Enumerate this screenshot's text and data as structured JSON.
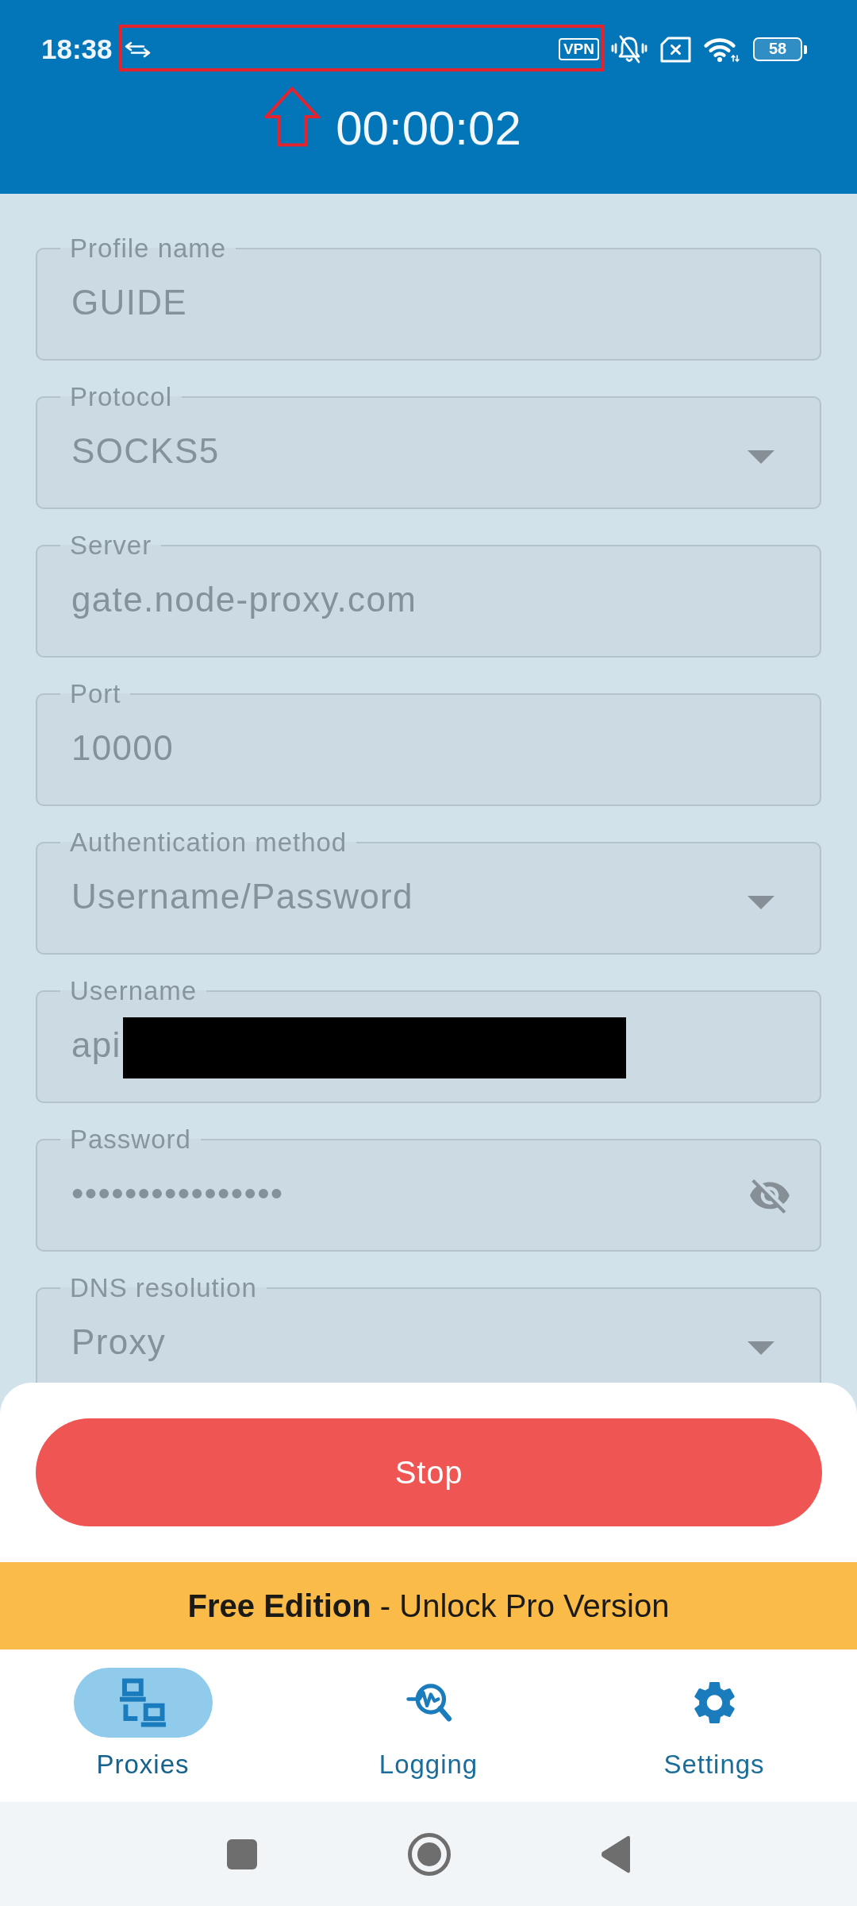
{
  "status_bar": {
    "time": "18:38",
    "vpn_badge": "VPN",
    "battery": "58"
  },
  "annotations": {
    "highlight_frame": true,
    "arrow": true
  },
  "header": {
    "timer": "00:00:02"
  },
  "form": {
    "disabled": true,
    "fields": [
      {
        "label": "Profile name",
        "value": "GUIDE",
        "kind": "text",
        "redacted": false
      },
      {
        "label": "Protocol",
        "value": "SOCKS5",
        "kind": "dropdown",
        "redacted": false
      },
      {
        "label": "Server",
        "value": "gate.node-proxy.com",
        "kind": "text",
        "redacted": false
      },
      {
        "label": "Port",
        "value": "10000",
        "kind": "text",
        "redacted": false
      },
      {
        "label": "Authentication method",
        "value": "Username/Password",
        "kind": "dropdown",
        "redacted": false
      },
      {
        "label": "Username",
        "value": "api",
        "kind": "text",
        "redacted": true
      },
      {
        "label": "Password",
        "value": "••••••••••••••••",
        "kind": "password",
        "redacted": false
      },
      {
        "label": "DNS resolution",
        "value": "Proxy",
        "kind": "dropdown",
        "redacted": false
      }
    ]
  },
  "stop_button": {
    "label": "Stop"
  },
  "banner": {
    "text": "**Free Edition** - Unlock Pro Version"
  },
  "bottom_nav": {
    "items": [
      {
        "label": "Proxies",
        "selected": true
      },
      {
        "label": "Logging",
        "selected": false
      },
      {
        "label": "Settings",
        "selected": false
      }
    ]
  }
}
